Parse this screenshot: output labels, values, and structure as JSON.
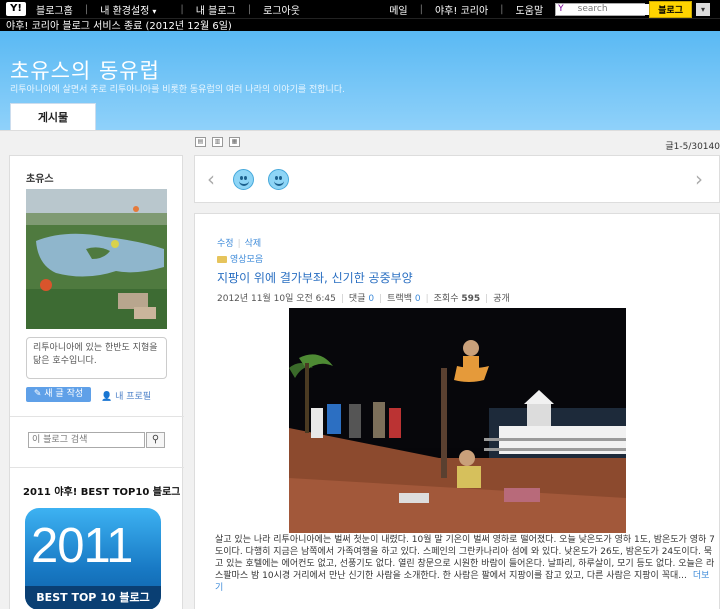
{
  "topbar": {
    "logo": "Y!",
    "nav": [
      "블로그홈",
      "내 환경설정",
      "내 블로그",
      "로그아웃"
    ],
    "right_links": [
      "메일",
      "야후! 코리아",
      "도움말"
    ],
    "search_placeholder": "search",
    "blog_button": "블로그"
  },
  "notice": "야후! 코리아 블로그 서비스 종료 (2012년 12월 6일)",
  "header": {
    "title": "초유스의 동유럽",
    "description": "리투아니아에 살면서 주로 리투아니아를 비롯한 동유럽의 여러 나라의 이야기를 전합니다.",
    "tab": "게시물"
  },
  "post_count": "글1-5/30140",
  "sidebar": {
    "profile_name": "초유스",
    "profile_intro": "리투아니아에 있는 한반도 지형을 닮은 호수입니다.",
    "write_button": "새 글 작성",
    "profile_button": "내 프로필",
    "search_placeholder": "이 블로그 검색",
    "best_title": "2011 야후! BEST TOP10 블로그",
    "best_year": "2011",
    "best_label": "BEST TOP 10 블로그"
  },
  "post": {
    "edit": "수정",
    "delete": "삭제",
    "category": "영상모음",
    "title": "지팡이 위에 결가부좌, 신기한 공중부양",
    "date": "2012년 11월 10일 오전 6:45",
    "comments_label": "댓글",
    "comments": "0",
    "trackbacks_label": "트랙백",
    "trackbacks": "0",
    "views_label": "조회수",
    "views": "595",
    "visibility": "공개",
    "body": "살고 있는 나라 리투아니아에는 벌써 첫눈이 내렸다. 10월 말 기온이 벌써 영하로 떨어졌다. 오늘 낮온도가 영하 1도, 밤온도가 영하 7도이다. 다행히 지금은 남쪽에서 가족여행을 하고 있다. 스페인의 그란카나리아 섬에 와 있다. 낮온도가 26도, 밤온도가 24도이다. 묵고 있는 호텔에는 에어컨도 없고, 선풍기도 없다. 열린 창문으로 시원한 바람이 들어온다. 날파리, 하루살이, 모기 등도 없다. 오늘은 라스팔마스 밤 10시경 거리에서 만난 신기한 사람을 소개한다. 한 사람은 팔에서 지팡이를 잡고 있고, 다른 사람은 지팡이 꼭대...",
    "more": "더보기"
  }
}
